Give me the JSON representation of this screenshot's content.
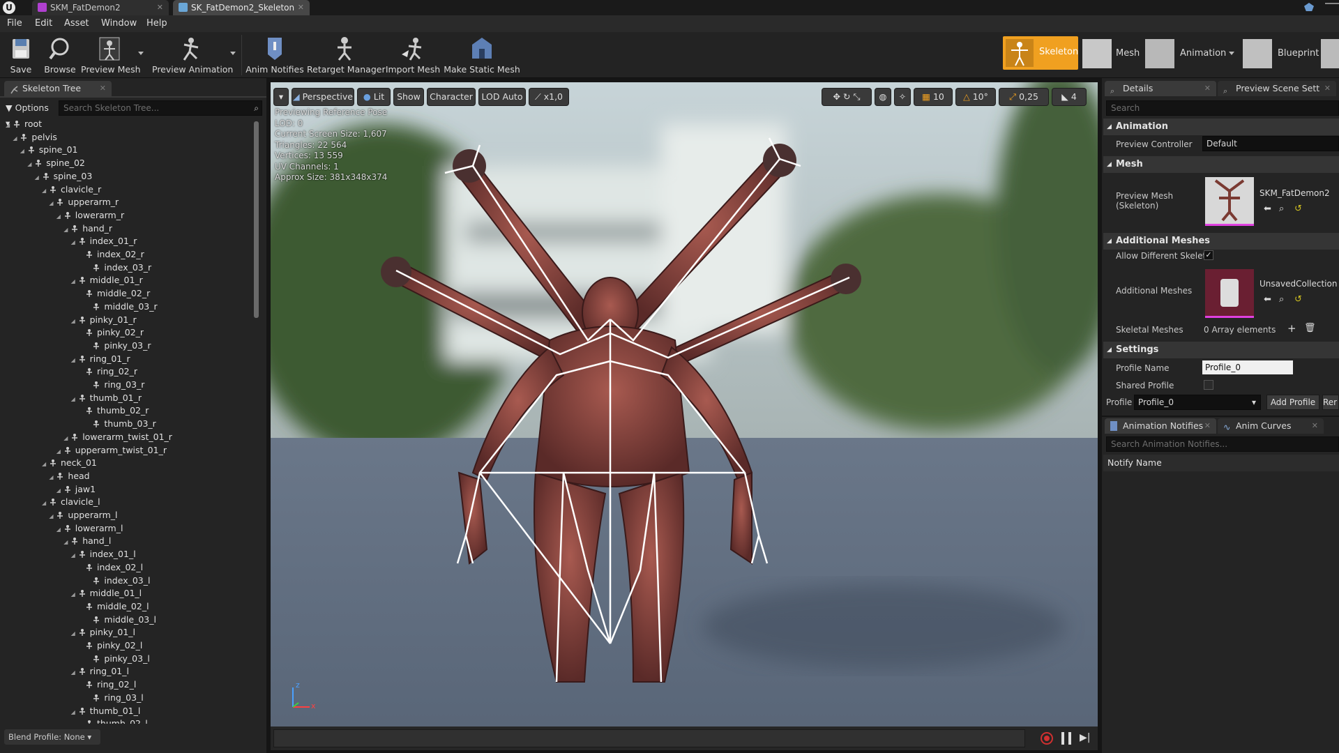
{
  "tabs": [
    {
      "label": "SKM_FatDemon2",
      "active": false
    },
    {
      "label": "SK_FatDemon2_Skeleton",
      "active": true
    }
  ],
  "menu": [
    "File",
    "Edit",
    "Asset",
    "Window",
    "Help"
  ],
  "toolbar": {
    "save": "Save",
    "browse": "Browse",
    "preview_mesh": "Preview Mesh",
    "preview_animation": "Preview Animation",
    "anim_notifies": "Anim Notifies",
    "retarget_manager": "Retarget Manager",
    "import_mesh": "Import Mesh",
    "make_static_mesh": "Make Static Mesh"
  },
  "modes": [
    {
      "label": "Skeleton",
      "active": true
    },
    {
      "label": "Mesh",
      "active": false
    },
    {
      "label": "Animation",
      "active": false
    },
    {
      "label": "Blueprint",
      "active": false
    }
  ],
  "skeleton_tree": {
    "tab": "Skeleton Tree",
    "options": "Options",
    "search_placeholder": "Search Skeleton Tree...",
    "bones": [
      {
        "name": "root",
        "depth": 0
      },
      {
        "name": "pelvis",
        "depth": 1
      },
      {
        "name": "spine_01",
        "depth": 2
      },
      {
        "name": "spine_02",
        "depth": 3
      },
      {
        "name": "spine_03",
        "depth": 4
      },
      {
        "name": "clavicle_r",
        "depth": 5
      },
      {
        "name": "upperarm_r",
        "depth": 6
      },
      {
        "name": "lowerarm_r",
        "depth": 7
      },
      {
        "name": "hand_r",
        "depth": 8
      },
      {
        "name": "index_01_r",
        "depth": 9
      },
      {
        "name": "index_02_r",
        "depth": 10
      },
      {
        "name": "index_03_r",
        "depth": 11
      },
      {
        "name": "middle_01_r",
        "depth": 9
      },
      {
        "name": "middle_02_r",
        "depth": 10
      },
      {
        "name": "middle_03_r",
        "depth": 11
      },
      {
        "name": "pinky_01_r",
        "depth": 9
      },
      {
        "name": "pinky_02_r",
        "depth": 10
      },
      {
        "name": "pinky_03_r",
        "depth": 11
      },
      {
        "name": "ring_01_r",
        "depth": 9
      },
      {
        "name": "ring_02_r",
        "depth": 10
      },
      {
        "name": "ring_03_r",
        "depth": 11
      },
      {
        "name": "thumb_01_r",
        "depth": 9
      },
      {
        "name": "thumb_02_r",
        "depth": 10
      },
      {
        "name": "thumb_03_r",
        "depth": 11
      },
      {
        "name": "lowerarm_twist_01_r",
        "depth": 8
      },
      {
        "name": "upperarm_twist_01_r",
        "depth": 7
      },
      {
        "name": "neck_01",
        "depth": 5
      },
      {
        "name": "head",
        "depth": 6
      },
      {
        "name": "jaw1",
        "depth": 7
      },
      {
        "name": "clavicle_l",
        "depth": 5
      },
      {
        "name": "upperarm_l",
        "depth": 6
      },
      {
        "name": "lowerarm_l",
        "depth": 7
      },
      {
        "name": "hand_l",
        "depth": 8
      },
      {
        "name": "index_01_l",
        "depth": 9
      },
      {
        "name": "index_02_l",
        "depth": 10
      },
      {
        "name": "index_03_l",
        "depth": 11
      },
      {
        "name": "middle_01_l",
        "depth": 9
      },
      {
        "name": "middle_02_l",
        "depth": 10
      },
      {
        "name": "middle_03_l",
        "depth": 11
      },
      {
        "name": "pinky_01_l",
        "depth": 9
      },
      {
        "name": "pinky_02_l",
        "depth": 10
      },
      {
        "name": "pinky_03_l",
        "depth": 11
      },
      {
        "name": "ring_01_l",
        "depth": 9
      },
      {
        "name": "ring_02_l",
        "depth": 10
      },
      {
        "name": "ring_03_l",
        "depth": 11
      },
      {
        "name": "thumb_01_l",
        "depth": 9
      },
      {
        "name": "thumb_02_l",
        "depth": 10
      }
    ],
    "blend_profile": "Blend Profile: None"
  },
  "viewport": {
    "perspective": "Perspective",
    "lit": "Lit",
    "show": "Show",
    "character": "Character",
    "lod": "LOD Auto",
    "speed": "x1,0",
    "grid_snap": "10",
    "rot_snap": "10°",
    "scale_snap": "0,25",
    "cam_speed": "4",
    "stats": [
      "Previewing Reference Pose",
      "LOD: 0",
      "Current Screen Size: 1,607",
      "Triangles: 22 564",
      "Vertices: 13 559",
      "UV Channels: 1",
      "Approx Size: 381x348x374"
    ],
    "axis_x": "x",
    "axis_z": "z"
  },
  "details": {
    "tab": "Details",
    "tab2": "Preview Scene Sett",
    "search_placeholder": "Search",
    "animation_header": "Animation",
    "preview_controller_label": "Preview Controller",
    "preview_controller_value": "Default",
    "mesh_header": "Mesh",
    "preview_mesh_label": "Preview Mesh (Skeleton)",
    "preview_mesh_value": "SKM_FatDemon2",
    "additional_meshes_header": "Additional Meshes",
    "allow_different_label": "Allow Different Skeleto",
    "additional_meshes_label": "Additional Meshes",
    "additional_meshes_value": "UnsavedCollection",
    "skeletal_meshes_label": "Skeletal Meshes",
    "skeletal_meshes_value": "0 Array elements",
    "settings_header": "Settings",
    "profile_name_label": "Profile Name",
    "profile_name_value": "Profile_0",
    "shared_profile_label": "Shared Profile",
    "profile_label": "Profile",
    "profile_value": "Profile_0",
    "add_profile": "Add Profile",
    "remove_profile": "Rer"
  },
  "notifies": {
    "tab": "Animation Notifies",
    "tab2": "Anim Curves",
    "search_placeholder": "Search Animation Notifies...",
    "column": "Notify Name"
  },
  "colors": {
    "accent": "#f0a020",
    "panel": "#242424",
    "viewport_floor": "#5f6e85"
  }
}
